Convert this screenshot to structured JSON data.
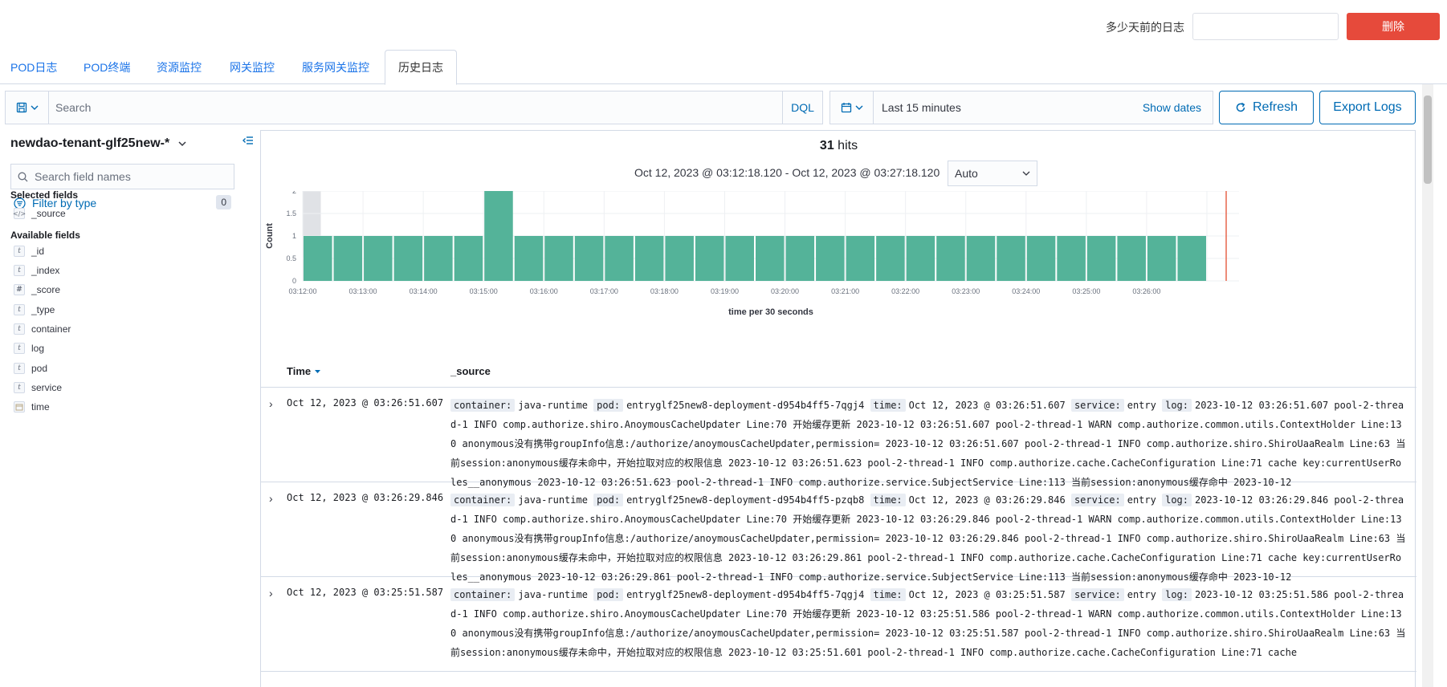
{
  "top": {
    "days_label": "多少天前的日志",
    "days_value": "",
    "delete_label": "删除"
  },
  "tabs": [
    {
      "label": "POD日志",
      "active": false
    },
    {
      "label": "POD终端",
      "active": false
    },
    {
      "label": "资源监控",
      "active": false
    },
    {
      "label": "网关监控",
      "active": false
    },
    {
      "label": "服务网关监控",
      "active": false
    },
    {
      "label": "历史日志",
      "active": true
    }
  ],
  "query": {
    "placeholder": "Search",
    "dql": "DQL",
    "time_range": "Last 15 minutes",
    "show_dates": "Show dates",
    "refresh": "Refresh",
    "export": "Export Logs"
  },
  "sidebar": {
    "index_pattern": "newdao-tenant-glf25new-*",
    "field_search_placeholder": "Search field names",
    "filter_by_type": "Filter by type",
    "filter_count": "0",
    "selected_title": "Selected fields",
    "selected_fields": [
      {
        "name": "_source",
        "type": "source"
      }
    ],
    "available_title": "Available fields",
    "available_fields": [
      {
        "name": "_id",
        "type": "t"
      },
      {
        "name": "_index",
        "type": "t"
      },
      {
        "name": "_score",
        "type": "#"
      },
      {
        "name": "_type",
        "type": "t"
      },
      {
        "name": "container",
        "type": "t"
      },
      {
        "name": "log",
        "type": "t"
      },
      {
        "name": "pod",
        "type": "t"
      },
      {
        "name": "service",
        "type": "t"
      },
      {
        "name": "time",
        "type": "date"
      }
    ]
  },
  "summary": {
    "hits_count": "31",
    "hits_label": "hits",
    "range": "Oct 12, 2023 @ 03:12:18.120 - Oct 12, 2023 @ 03:27:18.120",
    "interval": "Auto"
  },
  "chart_data": {
    "type": "bar",
    "ylabel": "Count",
    "xlabel": "time per 30 seconds",
    "ylim": [
      0,
      2
    ],
    "yticks": [
      "0",
      "0.5",
      "1",
      "1.5",
      "2"
    ],
    "x_ticks": [
      "03:12:00",
      "03:13:00",
      "03:14:00",
      "03:15:00",
      "03:16:00",
      "03:17:00",
      "03:18:00",
      "03:19:00",
      "03:20:00",
      "03:21:00",
      "03:22:00",
      "03:23:00",
      "03:24:00",
      "03:25:00",
      "03:26:00"
    ],
    "categories": [
      "03:12:00",
      "03:12:30",
      "03:13:00",
      "03:13:30",
      "03:14:00",
      "03:14:30",
      "03:15:00",
      "03:15:30",
      "03:16:00",
      "03:16:30",
      "03:17:00",
      "03:17:30",
      "03:18:00",
      "03:18:30",
      "03:19:00",
      "03:19:30",
      "03:20:00",
      "03:20:30",
      "03:21:00",
      "03:21:30",
      "03:22:00",
      "03:22:30",
      "03:23:00",
      "03:23:30",
      "03:24:00",
      "03:24:30",
      "03:25:00",
      "03:25:30",
      "03:26:00",
      "03:26:30"
    ],
    "values": [
      1,
      1,
      1,
      1,
      1,
      1,
      2,
      1,
      1,
      1,
      1,
      1,
      1,
      1,
      1,
      1,
      1,
      1,
      1,
      1,
      1,
      1,
      1,
      1,
      1,
      1,
      1,
      1,
      1,
      1
    ],
    "bar_color": "#54b399",
    "grid": true
  },
  "table": {
    "col_time": "Time",
    "col_source": "_source",
    "rows": [
      {
        "time": "Oct 12, 2023 @ 03:26:51.607",
        "container": "java-runtime",
        "pod": "entryglf25new8-deployment-d954b4ff5-7qgj4",
        "time_val": "Oct 12, 2023 @ 03:26:51.607",
        "service": "entry",
        "log": "2023-10-12 03:26:51.607 pool-2-thread-1 INFO comp.authorize.shiro.AnoymousCacheUpdater Line:70 开始缓存更新 2023-10-12 03:26:51.607 pool-2-thread-1 WARN comp.authorize.common.utils.ContextHolder Line:130 anonymous没有携带groupInfo信息:/authorize/anoymousCacheUpdater,permission= 2023-10-12 03:26:51.607 pool-2-thread-1 INFO comp.authorize.shiro.ShiroUaaRealm Line:63 当前session:anonymous缓存未命中，开始拉取对应的权限信息 2023-10-12 03:26:51.623 pool-2-thread-1 INFO comp.authorize.cache.CacheConfiguration Line:71 cache key:currentUserRoles__anonymous 2023-10-12 03:26:51.623 pool-2-thread-1 INFO comp.authorize.service.SubjectService Line:113 当前session:anonymous缓存命中 2023-10-12"
      },
      {
        "time": "Oct 12, 2023 @ 03:26:29.846",
        "container": "java-runtime",
        "pod": "entryglf25new8-deployment-d954b4ff5-pzqb8",
        "time_val": "Oct 12, 2023 @ 03:26:29.846",
        "service": "entry",
        "log": "2023-10-12 03:26:29.846 pool-2-thread-1 INFO comp.authorize.shiro.AnoymousCacheUpdater Line:70 开始缓存更新 2023-10-12 03:26:29.846 pool-2-thread-1 WARN comp.authorize.common.utils.ContextHolder Line:130 anonymous没有携带groupInfo信息:/authorize/anoymousCacheUpdater,permission= 2023-10-12 03:26:29.846 pool-2-thread-1 INFO comp.authorize.shiro.ShiroUaaRealm Line:63 当前session:anonymous缓存未命中，开始拉取对应的权限信息 2023-10-12 03:26:29.861 pool-2-thread-1 INFO comp.authorize.cache.CacheConfiguration Line:71 cache key:currentUserRoles__anonymous 2023-10-12 03:26:29.861 pool-2-thread-1 INFO comp.authorize.service.SubjectService Line:113 当前session:anonymous缓存命中 2023-10-12"
      },
      {
        "time": "Oct 12, 2023 @ 03:25:51.587",
        "container": "java-runtime",
        "pod": "entryglf25new8-deployment-d954b4ff5-7qgj4",
        "time_val": "Oct 12, 2023 @ 03:25:51.587",
        "service": "entry",
        "log": "2023-10-12 03:25:51.586 pool-2-thread-1 INFO comp.authorize.shiro.AnoymousCacheUpdater Line:70 开始缓存更新 2023-10-12 03:25:51.586 pool-2-thread-1 WARN comp.authorize.common.utils.ContextHolder Line:130 anonymous没有携带groupInfo信息:/authorize/anoymousCacheUpdater,permission= 2023-10-12 03:25:51.587 pool-2-thread-1 INFO comp.authorize.shiro.ShiroUaaRealm Line:63 当前session:anonymous缓存未命中，开始拉取对应的权限信息 2023-10-12 03:25:51.601 pool-2-thread-1 INFO comp.authorize.cache.CacheConfiguration Line:71 cache"
      }
    ]
  }
}
